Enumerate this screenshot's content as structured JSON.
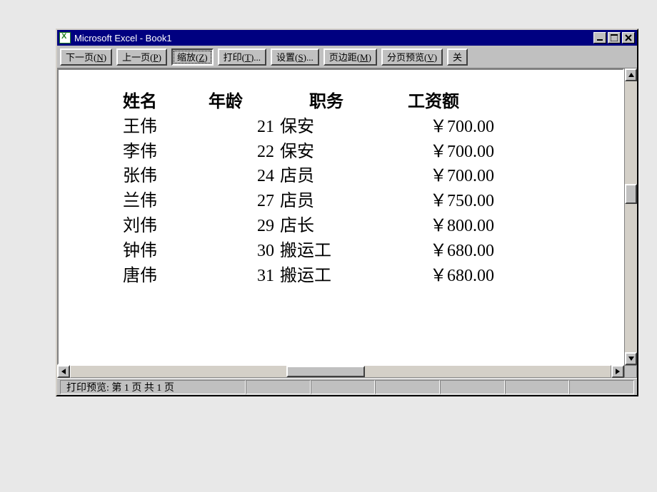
{
  "window": {
    "title": "Microsoft Excel - Book1"
  },
  "toolbar": {
    "next": {
      "pre": "下一页(",
      "mnem": "N",
      "post": ")"
    },
    "prev": {
      "pre": "上一页(",
      "mnem": "P",
      "post": ")"
    },
    "zoom": {
      "pre": "缩放(",
      "mnem": "Z",
      "post": ")"
    },
    "print": {
      "pre": "打印(",
      "mnem": "T",
      "post": ")..."
    },
    "setup": {
      "pre": "设置(",
      "mnem": "S",
      "post": ")..."
    },
    "margin": {
      "pre": "页边距(",
      "mnem": "M",
      "post": ")"
    },
    "pbview": {
      "pre": "分页预览(",
      "mnem": "V",
      "post": ")"
    },
    "close": {
      "pre": "关",
      "mnem": "",
      "post": ""
    }
  },
  "headers": {
    "name": "姓名",
    "age": "年龄",
    "job": "职务",
    "salary": "工资额"
  },
  "rows": [
    {
      "name": "王伟",
      "age": "21",
      "job": "保安",
      "salary": "￥700.00"
    },
    {
      "name": "李伟",
      "age": "22",
      "job": "保安",
      "salary": "￥700.00"
    },
    {
      "name": "张伟",
      "age": "24",
      "job": "店员",
      "salary": "￥700.00"
    },
    {
      "name": "兰伟",
      "age": "27",
      "job": "店员",
      "salary": "￥750.00"
    },
    {
      "name": "刘伟",
      "age": "29",
      "job": "店长",
      "salary": "￥800.00"
    },
    {
      "name": "钟伟",
      "age": "30",
      "job": "搬运工",
      "salary": "￥680.00"
    },
    {
      "name": "唐伟",
      "age": "31",
      "job": "搬运工",
      "salary": "￥680.00"
    }
  ],
  "status": {
    "text": "打印预览: 第 1 页  共 1 页"
  }
}
